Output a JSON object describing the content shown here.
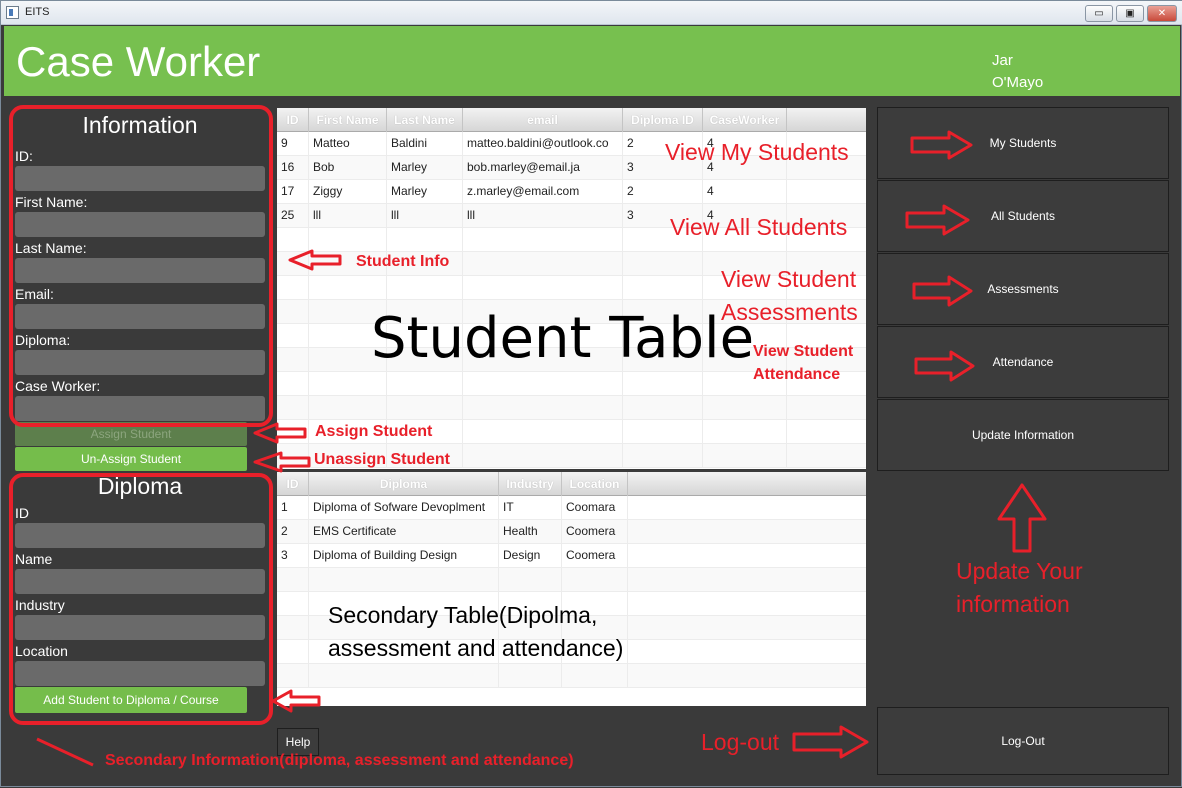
{
  "window": {
    "title": "EITS",
    "minimize": "▭",
    "maximize": "▣",
    "close": "✕"
  },
  "header": {
    "title": "Case Worker",
    "user_first": "Jar",
    "user_last": "O'Mayo"
  },
  "info_panel": {
    "title": "Information",
    "labels": [
      "ID:",
      "First Name:",
      "Last Name:",
      "Email:",
      "Diploma:",
      "Case Worker:"
    ],
    "assign_button": "Assign Student",
    "unassign_button": "Un-Assign Student"
  },
  "diploma_panel": {
    "title": "Diploma",
    "labels": [
      "ID",
      "Name",
      "Industry",
      "Location"
    ],
    "add_button": "Add Student to Diploma / Course"
  },
  "student_table": {
    "columns": [
      "ID",
      "First Name",
      "Last Name",
      "email",
      "Diploma ID",
      "CaseWorker"
    ],
    "rows": [
      [
        "9",
        "Matteo",
        "Baldini",
        "matteo.baldini@outlook.co",
        "2",
        "4"
      ],
      [
        "16",
        "Bob",
        "Marley",
        "bob.marley@email.ja",
        "3",
        "4"
      ],
      [
        "17",
        "Ziggy",
        "Marley",
        "z.marley@email.com",
        "2",
        "4"
      ],
      [
        "25",
        "lll",
        "lll",
        "lll",
        "3",
        "4"
      ]
    ]
  },
  "secondary_table": {
    "columns": [
      "ID",
      "Diploma",
      "Industry",
      "Location"
    ],
    "rows": [
      [
        "1",
        "Diploma of Sofware Devoplment",
        "IT",
        "Coomara"
      ],
      [
        "2",
        "EMS Certificate",
        "Health",
        "Coomera"
      ],
      [
        "3",
        "Diploma of Building Design",
        "Design",
        "Coomera"
      ]
    ]
  },
  "nav_buttons": {
    "my_students": "My Students",
    "all_students": "All Students",
    "assessments": "Assessments",
    "attendance": "Attendance",
    "update_info": "Update Information",
    "logout": "Log-Out",
    "help": "Help"
  },
  "annotations": {
    "student_table": "Student Table",
    "secondary_table": "Secondary Table(Dipolma, assessment and attendance)",
    "view_my_students": "View My Students",
    "view_all_students": "View All Students",
    "view_assessments_1": "View Student",
    "view_assessments_2": "Assessments",
    "view_attendance_1": "View Student",
    "view_attendance_2": "Attendance",
    "student_info": "Student Info",
    "assign_student": "Assign Student",
    "unassign_student": "Unassign Student",
    "update_info_1": "Update Your",
    "update_info_2": "information",
    "logout": "Log-out",
    "secondary_info": "Secondary Information(diploma, assessment and attendance)"
  },
  "colors": {
    "header_green": "#77c04f",
    "annotation_red": "#e8202a",
    "background": "#3a3a3a"
  }
}
